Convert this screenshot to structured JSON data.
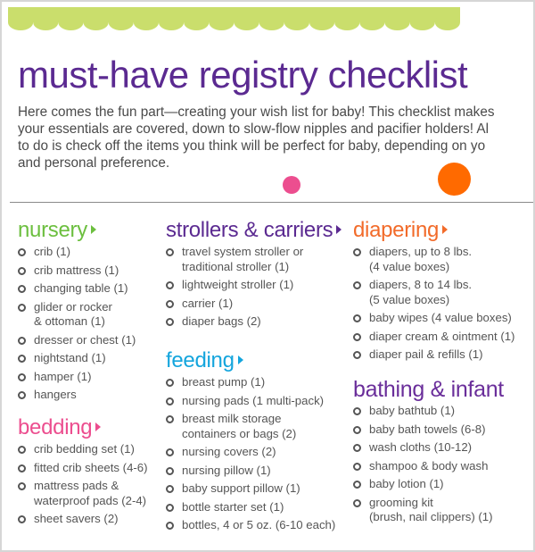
{
  "header": {
    "title": "must-have registry checklist",
    "intro_lines": [
      "Here comes the fun part—creating your wish list for baby! This checklist makes",
      "your essentials are covered, down to slow-flow nipples and pacifier holders! Al",
      "to do is check off the items you think will be perfect for baby, depending on yo",
      "and personal preference."
    ]
  },
  "colors": {
    "scallop": "#cade6c",
    "title": "#5b2a91",
    "nursery": "#6cbf3f",
    "bedding": "#ec4e8f",
    "strollers": "#5b2a91",
    "feeding": "#14a5dd",
    "diapering": "#f26b2a",
    "bathing": "#6a2e9a",
    "dot_pink": "#ec4e8f",
    "dot_orange": "#ff6a00",
    "body_text": "#555555"
  },
  "sections": {
    "nursery": {
      "title": "nursery",
      "items": [
        [
          "crib (1)"
        ],
        [
          "crib mattress (1)"
        ],
        [
          "changing table (1)"
        ],
        [
          "glider or rocker",
          "& ottoman (1)"
        ],
        [
          "dresser or chest (1)"
        ],
        [
          "nightstand (1)"
        ],
        [
          "hamper (1)"
        ],
        [
          "hangers"
        ]
      ]
    },
    "bedding": {
      "title": "bedding",
      "items": [
        [
          "crib bedding set (1)"
        ],
        [
          "fitted crib sheets (4-6)"
        ],
        [
          "mattress pads &",
          "waterproof pads (2-4)"
        ],
        [
          "sheet savers (2)"
        ]
      ]
    },
    "strollers": {
      "title": "strollers & carriers",
      "items": [
        [
          "travel system stroller or",
          "traditional stroller (1)"
        ],
        [
          "lightweight stroller (1)"
        ],
        [
          "carrier (1)"
        ],
        [
          "diaper bags (2)"
        ]
      ]
    },
    "feeding": {
      "title": "feeding",
      "items": [
        [
          "breast pump (1)"
        ],
        [
          "nursing pads (1 multi-pack)"
        ],
        [
          "breast milk storage",
          "containers or bags (2)"
        ],
        [
          "nursing covers (2)"
        ],
        [
          "nursing pillow (1)"
        ],
        [
          "baby support pillow (1)"
        ],
        [
          "bottle starter set (1)"
        ],
        [
          "bottles, 4 or 5 oz. (6-10 each)"
        ]
      ]
    },
    "diapering": {
      "title": "diapering",
      "items": [
        [
          "diapers, up to 8 lbs.",
          "(4 value boxes)"
        ],
        [
          "diapers, 8 to 14 lbs.",
          "(5 value boxes)"
        ],
        [
          "baby wipes (4 value boxes)"
        ],
        [
          "diaper cream & ointment (1)"
        ],
        [
          "diaper pail & refills (1)"
        ]
      ]
    },
    "bathing": {
      "title": "bathing & infant",
      "items": [
        [
          "baby bathtub (1)"
        ],
        [
          "baby bath towels (6-8)"
        ],
        [
          "wash cloths (10-12)"
        ],
        [
          "shampoo & body wash"
        ],
        [
          "baby lotion (1)"
        ],
        [
          "grooming kit",
          "(brush, nail clippers) (1)"
        ]
      ]
    }
  }
}
